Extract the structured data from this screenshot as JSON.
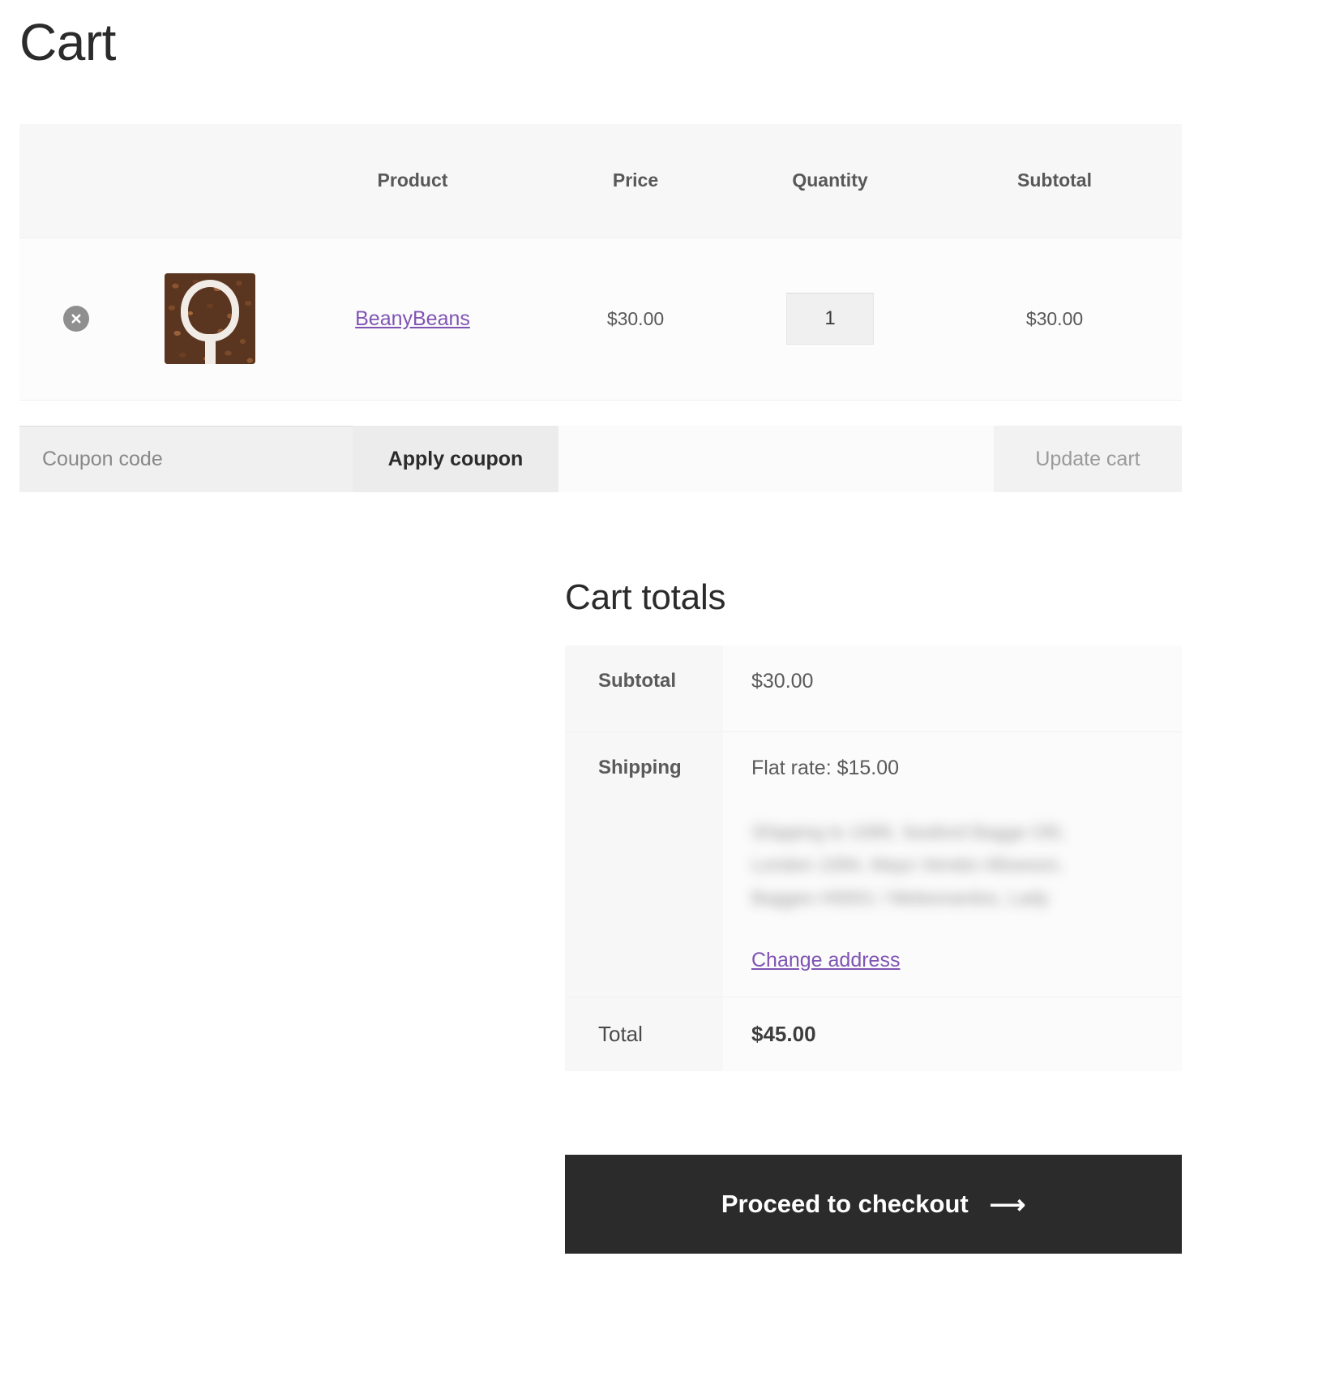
{
  "page": {
    "title": "Cart"
  },
  "cart_table": {
    "headers": {
      "remove": "",
      "thumbnail": "",
      "product": "Product",
      "price": "Price",
      "quantity": "Quantity",
      "subtotal": "Subtotal"
    },
    "rows": [
      {
        "remove_icon": "remove-circle-x-icon",
        "thumbnail_icon": "coffee-beans-scoop-image",
        "product_name": "BeanyBeans",
        "price": "$30.00",
        "quantity": "1",
        "subtotal": "$30.00"
      }
    ]
  },
  "actions": {
    "coupon_placeholder": "Coupon code",
    "coupon_value": "",
    "apply_coupon_label": "Apply coupon",
    "update_cart_label": "Update cart"
  },
  "cart_totals": {
    "heading": "Cart totals",
    "subtotal_label": "Subtotal",
    "subtotal_value": "$30.00",
    "shipping_label": "Shipping",
    "shipping_method": "Flat rate: $15.00",
    "address_lines": [
      "Shipping to 1089, Seaford Bagge Ol0,",
      "London 1084, Mays Vendor Allowson,",
      "Bagges H0001 / Meleonardos, Lady"
    ],
    "change_address_label": "Change address",
    "total_label": "Total",
    "total_value": "$45.00"
  },
  "checkout": {
    "label": "Proceed to checkout",
    "arrow_icon": "arrow-right-icon",
    "arrow_glyph": "⟶"
  },
  "colors": {
    "accent_link": "#7F54B3",
    "checkout_bg": "#2B2B2B",
    "header_bg": "#F7F7F7",
    "row_bg": "#FCFCFC"
  }
}
